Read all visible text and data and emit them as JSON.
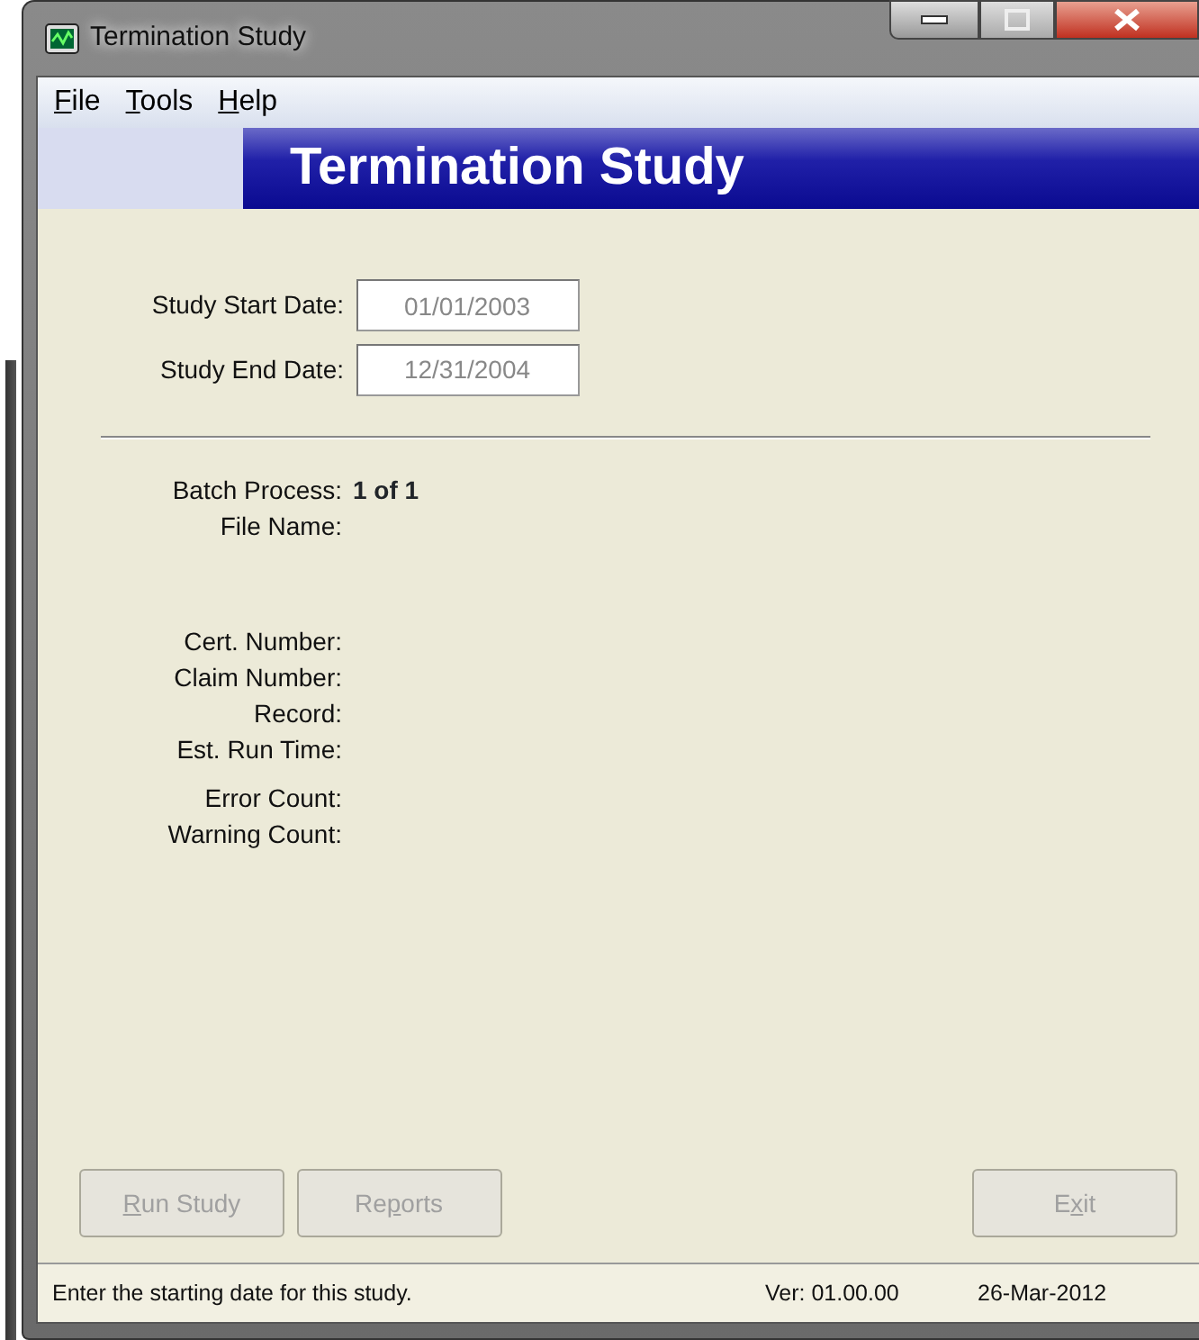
{
  "window": {
    "title": "Termination Study"
  },
  "menu": [
    {
      "key": "F",
      "post": "ile"
    },
    {
      "key": "T",
      "post": "ools"
    },
    {
      "key": "H",
      "post": "elp"
    }
  ],
  "banner": "Termination Study",
  "dates": [
    {
      "label": "Study Start Date:",
      "value": "01/01/2003"
    },
    {
      "label": "Study End Date:",
      "value": "12/31/2004"
    }
  ],
  "info_groups": [
    [
      {
        "label": "Batch Process:",
        "value": "1 of 1"
      },
      {
        "label": "File Name:"
      }
    ],
    [
      {
        "label": "Cert. Number:"
      },
      {
        "label": "Claim Number:"
      },
      {
        "label": "Record:"
      },
      {
        "label": "Est. Run Time:"
      }
    ],
    [
      {
        "label": "Error Count:"
      },
      {
        "label": "Warning Count:"
      }
    ]
  ],
  "buttons_left": [
    {
      "key": "R",
      "post": "un Study",
      "disabled": true
    },
    {
      "pre": "Re",
      "key": "p",
      "post": "orts",
      "disabled": true
    }
  ],
  "buttons_right": [
    {
      "pre": "E",
      "key": "x",
      "post": "it",
      "disabled": true
    }
  ],
  "status_bar": {
    "message": "Enter the starting date for this study.",
    "version": "Ver: 01.00.00",
    "date": "26-Mar-2012"
  }
}
